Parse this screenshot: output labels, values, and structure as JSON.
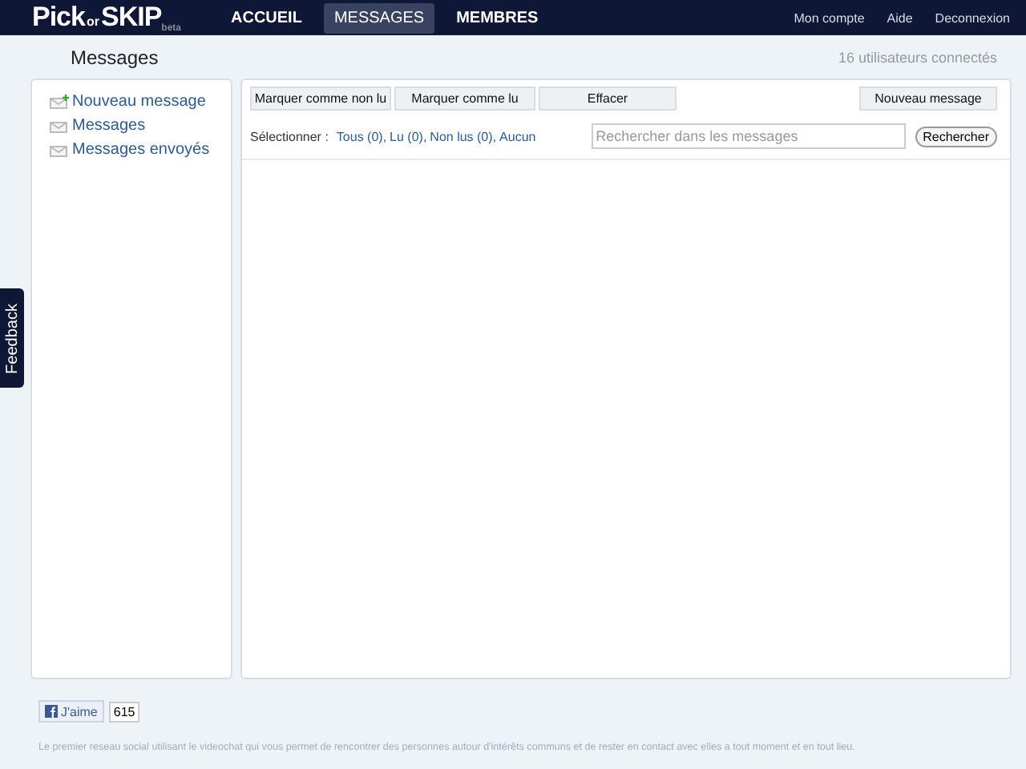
{
  "logo": {
    "name_start": "Pick",
    "name_or": "or",
    "name_end": "SKIP",
    "tag": "beta"
  },
  "nav": [
    {
      "label": "ACCUEIL",
      "selected": false
    },
    {
      "label": "MESSAGES",
      "selected": true
    },
    {
      "label": "MEMBRES",
      "selected": false
    }
  ],
  "account_links": [
    "Mon compte",
    "Aide",
    "Deconnexion"
  ],
  "page_title": "Messages",
  "online_count": "16 utilisateurs connectés",
  "sidebar": {
    "items": [
      {
        "label": "Nouveau message",
        "kind": "new"
      },
      {
        "label": "Messages",
        "kind": "inbox"
      },
      {
        "label": "Messages envoyés",
        "kind": "sent"
      }
    ]
  },
  "toolbar": {
    "buttons": [
      "Marquer comme non lu",
      "Marquer comme lu",
      "Effacer"
    ],
    "new_button": "Nouveau message"
  },
  "select": {
    "label": "Sélectionner :",
    "links": [
      "Tous (0),",
      "Lu (0),",
      "Non lus (0),",
      "Aucun"
    ]
  },
  "search": {
    "placeholder": "Rechercher dans les messages",
    "button": "Rechercher"
  },
  "feedback": "Feedback",
  "like": {
    "label": "J'aime",
    "count": "615"
  },
  "footer_text": "Le premier reseau social utilisant le videochat qui vous permet de rencontrer des personnes autour d'intérêts communs et de rester en contact avec elles a tout moment et en tout lieu."
}
